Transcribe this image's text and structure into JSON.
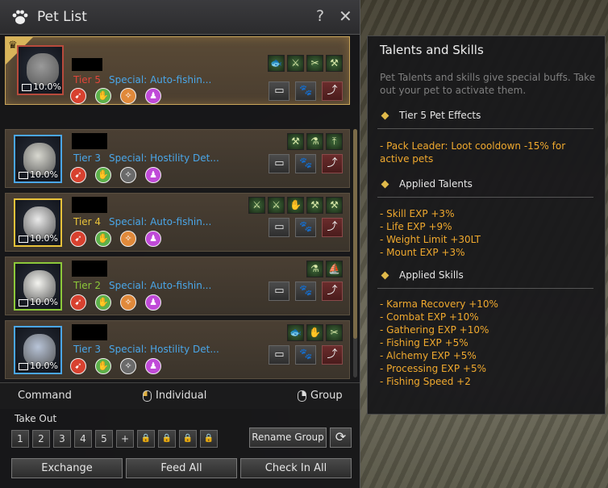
{
  "window": {
    "title": "Pet List",
    "help": "?",
    "close": "✕"
  },
  "pets": [
    {
      "tier": "Tier 5",
      "tier_color": "#e0463a",
      "special": "Special: Auto-fishin...",
      "capacity": "10.0%",
      "selected": true,
      "skills": [
        {
          "color": "#d8412f",
          "glyph": "➹"
        },
        {
          "color": "#5db04a",
          "glyph": "✋"
        },
        {
          "color": "#e0893a",
          "glyph": "✧"
        },
        {
          "color": "#c04ad8",
          "glyph": "♟"
        }
      ],
      "talents": [
        "🐟",
        "⚔",
        "✂",
        "⚒"
      ]
    },
    {
      "tier": "Tier 3",
      "tier_color": "#4aa6e8",
      "special": "Special: Hostility Det...",
      "capacity": "10.0%",
      "selected": false,
      "skills": [
        {
          "color": "#d8412f",
          "glyph": "➹"
        },
        {
          "color": "#5db04a",
          "glyph": "✋"
        },
        {
          "color": "#6a6a6a",
          "glyph": "✧"
        },
        {
          "color": "#c04ad8",
          "glyph": "♟"
        }
      ],
      "talents": [
        "⚒",
        "⚗",
        "⤒"
      ]
    },
    {
      "tier": "Tier 4",
      "tier_color": "#e8c23a",
      "special": "Special: Auto-fishin...",
      "capacity": "10.0%",
      "selected": false,
      "skills": [
        {
          "color": "#d8412f",
          "glyph": "➹"
        },
        {
          "color": "#5db04a",
          "glyph": "✋"
        },
        {
          "color": "#e0893a",
          "glyph": "✧"
        },
        {
          "color": "#c04ad8",
          "glyph": "♟"
        }
      ],
      "talents": [
        "⚔",
        "⚔",
        "✋",
        "⚒",
        "⚒"
      ]
    },
    {
      "tier": "Tier 2",
      "tier_color": "#8cc83a",
      "special": "Special: Auto-fishin...",
      "capacity": "10.0%",
      "selected": false,
      "skills": [
        {
          "color": "#d8412f",
          "glyph": "➹"
        },
        {
          "color": "#5db04a",
          "glyph": "✋"
        },
        {
          "color": "#e0893a",
          "glyph": "✧"
        },
        {
          "color": "#c04ad8",
          "glyph": "♟"
        }
      ],
      "talents": [
        "⚗",
        "⛵"
      ]
    },
    {
      "tier": "Tier 3",
      "tier_color": "#4aa6e8",
      "special": "Special: Hostility Det...",
      "capacity": "10.0%",
      "selected": false,
      "skills": [
        {
          "color": "#d8412f",
          "glyph": "➹"
        },
        {
          "color": "#5db04a",
          "glyph": "✋"
        },
        {
          "color": "#6a6a6a",
          "glyph": "✧"
        },
        {
          "color": "#c04ad8",
          "glyph": "♟"
        }
      ],
      "talents": [
        "🐟",
        "✋",
        "✂"
      ]
    }
  ],
  "command_bar": {
    "command": "Command",
    "individual": "Individual",
    "group": "Group"
  },
  "take_out": {
    "label": "Take Out",
    "slots": [
      "1",
      "2",
      "3",
      "4",
      "5",
      "+"
    ],
    "locked_count": 4,
    "rename_group": "Rename Group",
    "refresh_icon": "⟳"
  },
  "bottom": {
    "exchange": "Exchange",
    "feed_all": "Feed All",
    "check_in_all": "Check In All"
  },
  "tooltip": {
    "title": "Talents and Skills",
    "desc": "Pet Talents and skills give special buffs. Take out your pet to activate them.",
    "tier_effects_header": "Tier 5 Pet Effects",
    "tier_effects": [
      "- Pack Leader: Loot cooldown -15% for active pets"
    ],
    "talents_header": "Applied Talents",
    "talents": [
      "- Skill EXP +3%",
      "- Life EXP +9%",
      "- Weight Limit +30LT",
      "- Mount EXP +3%"
    ],
    "skills_header": "Applied Skills",
    "skills": [
      "- Karma Recovery +10%",
      "- Combat EXP +10%",
      "- Gathering EXP +10%",
      "- Fishing EXP +5%",
      "- Alchemy EXP +5%",
      "- Processing EXP +5%",
      "- Fishing Speed +2"
    ]
  },
  "colors": {
    "accent_gold": "#d8b45a",
    "special_blue": "#4aa6e8",
    "tooltip_orange": "#f0a92e"
  }
}
